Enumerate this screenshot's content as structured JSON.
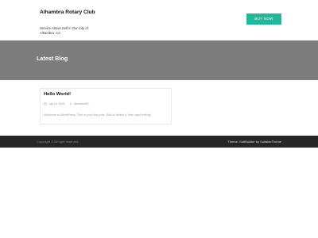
{
  "header": {
    "site_title": "Alhambra Rotary Club",
    "site_description": "Service Above Self in Our City of Alhambra, CA",
    "buy_button_label": "BUY NOW"
  },
  "banner": {
    "title": "Latest Blog"
  },
  "post": {
    "title": "Hello World!",
    "date": "July 16, 2019",
    "author": "AlhambraRC",
    "excerpt": "Welcome to WordPress. This is your first post. Edit or delete it, then start writing!"
  },
  "footer": {
    "copyright": "Copyright © All right reserved.",
    "theme_credit": "Theme: SoftBuilder by SuitableTheme"
  },
  "colors": {
    "accent": "#1fb99b",
    "banner_bg": "#7d7d7d",
    "footer_bg": "#262626"
  },
  "icons": {
    "date": "calendar-icon",
    "author": "user-icon"
  }
}
